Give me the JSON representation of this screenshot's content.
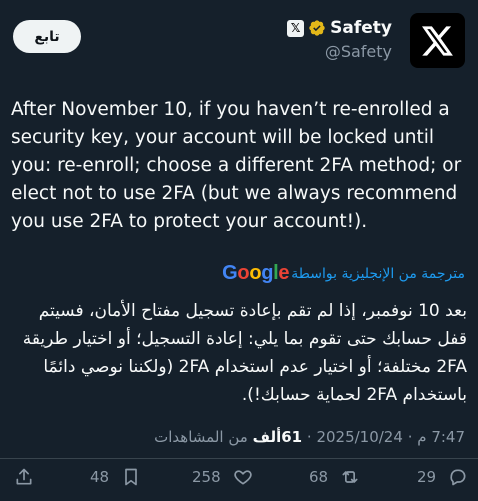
{
  "header": {
    "follow_label": "تابع",
    "display_name": "Safety",
    "handle": "@Safety",
    "badge_letter": "𝕏",
    "verified_color": "#e2b719"
  },
  "tweet": {
    "text": "After November 10, if you haven’t re-enrolled a security key, your account will be locked until you: re-enroll; choose a different 2FA method; or elect not to use 2FA (but we always recommend you use 2FA to protect your account!).",
    "translated_by_label": "مترجمة من الإنجليزية بواسطة",
    "translated_provider": "Google",
    "translation": "بعد 10 نوفمبر، إذا لم تقم بإعادة تسجيل مفتاح الأمان، فسيتم قفل حسابك حتى تقوم بما يلي: إعادة التسجيل؛ أو اختيار طريقة 2FA مختلفة؛ أو اختيار عدم استخدام 2FA (ولكننا نوصي دائمًا باستخدام 2FA لحماية حسابك!).",
    "time": "7:47 م",
    "date": "2025/10/24",
    "views_count": "61ألف",
    "views_label": "من المشاهدات",
    "separator": "·"
  },
  "actions": {
    "replies": "29",
    "reposts": "68",
    "likes": "258",
    "bookmarks": "48"
  },
  "colors": {
    "background": "#15202b",
    "link": "#1d9bf0",
    "muted": "#8b98a5"
  }
}
